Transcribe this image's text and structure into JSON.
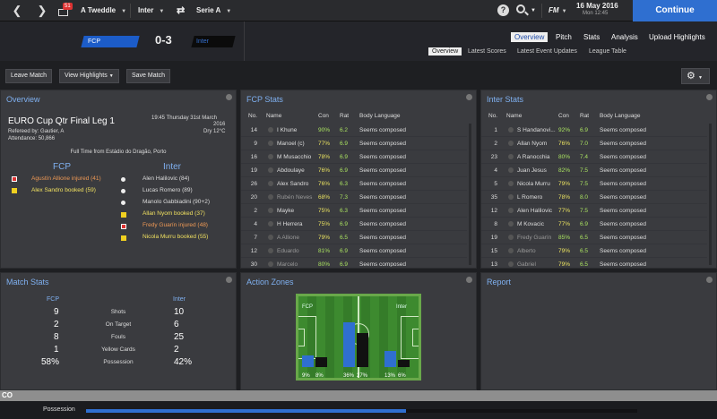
{
  "topbar": {
    "mail_badge": "51",
    "manager": "A Tweddle",
    "team": "Inter",
    "competition": "Serie A",
    "help": "?",
    "fm_label": "FM",
    "date": "16 May 2016",
    "time": "Mon 12:45",
    "continue": "Continue"
  },
  "match": {
    "home_team": "FCP",
    "away_team": "Inter",
    "score": "0-3"
  },
  "tabs": [
    "Overview",
    "Pitch",
    "Stats",
    "Analysis",
    "Upload Highlights"
  ],
  "subtabs": [
    "Overview",
    "Latest Scores",
    "Latest Event Updates",
    "League Table"
  ],
  "toolbar": {
    "leave": "Leave Match",
    "highlights": "View Highlights",
    "save": "Save Match"
  },
  "overview": {
    "title": "Overview",
    "match_title": "EURO Cup Qtr Final Leg 1",
    "kickoff": "19:45 Thursday 31st March",
    "year": "2016",
    "referee": "Refereed by: Gautier, A",
    "weather": "Dry 12°C",
    "attendance": "Attendance: 50,866",
    "full_time": "Full Time from Estádio do Dragão, Porto",
    "home_head": "FCP",
    "away_head": "Inter",
    "home_events": [
      {
        "text": "Agustín Allione injured (41)",
        "kind": "inj"
      },
      {
        "text": "Alex Sandro booked (59)",
        "kind": "yel"
      }
    ],
    "away_events": [
      {
        "text": "Alen Halilovic (84)",
        "kind": "goal"
      },
      {
        "text": "Lucas Romero (89)",
        "kind": "goal"
      },
      {
        "text": "Manolo Gabbiadini (90+2)",
        "kind": "goal"
      },
      {
        "text": "Allan Nyom booked (37)",
        "kind": "yel"
      },
      {
        "text": "Fredy Guarín injured (48)",
        "kind": "inj"
      },
      {
        "text": "Nicola Murru booked (55)",
        "kind": "yel"
      }
    ]
  },
  "fcp_stats": {
    "title": "FCP Stats",
    "headers": {
      "no": "No.",
      "name": "Name",
      "con": "Con",
      "rat": "Rat",
      "body": "Body Language"
    },
    "rows": [
      {
        "no": "14",
        "name": "I Khune",
        "con": "90%",
        "rat": "6.2",
        "body": "Seems composed",
        "sub": false
      },
      {
        "no": "9",
        "name": "Manoel (c)",
        "con": "77%",
        "rat": "6.9",
        "body": "Seems composed",
        "sub": false
      },
      {
        "no": "16",
        "name": "M Musacchio",
        "con": "78%",
        "rat": "6.9",
        "body": "Seems composed",
        "sub": false
      },
      {
        "no": "19",
        "name": "Abdoulaye",
        "con": "76%",
        "rat": "6.9",
        "body": "Seems composed",
        "sub": false
      },
      {
        "no": "26",
        "name": "Alex Sandro",
        "con": "76%",
        "rat": "6.3",
        "body": "Seems composed",
        "sub": false
      },
      {
        "no": "20",
        "name": "Rubén Neves",
        "con": "68%",
        "rat": "7.3",
        "body": "Seems composed",
        "sub": true
      },
      {
        "no": "2",
        "name": "Mayke",
        "con": "75%",
        "rat": "6.3",
        "body": "Seems composed",
        "sub": false
      },
      {
        "no": "4",
        "name": "H Herrera",
        "con": "75%",
        "rat": "6.9",
        "body": "Seems composed",
        "sub": false
      },
      {
        "no": "7",
        "name": "A Allione",
        "con": "79%",
        "rat": "6.5",
        "body": "Seems composed",
        "sub": true
      },
      {
        "no": "12",
        "name": "Eduardo",
        "con": "81%",
        "rat": "6.9",
        "body": "Seems composed",
        "sub": true
      },
      {
        "no": "30",
        "name": "Marcelo",
        "con": "80%",
        "rat": "6.9",
        "body": "Seems composed",
        "sub": true
      }
    ]
  },
  "inter_stats": {
    "title": "Inter Stats",
    "headers": {
      "no": "No.",
      "name": "Name",
      "con": "Con",
      "rat": "Rat",
      "body": "Body Language"
    },
    "rows": [
      {
        "no": "1",
        "name": "S Handanovi...",
        "con": "92%",
        "rat": "6.9",
        "body": "Seems composed",
        "sub": false
      },
      {
        "no": "2",
        "name": "Allan Nyom",
        "con": "76%",
        "rat": "7.0",
        "body": "Seems composed",
        "sub": false
      },
      {
        "no": "23",
        "name": "A Ranocchia",
        "con": "80%",
        "rat": "7.4",
        "body": "Seems composed",
        "sub": false
      },
      {
        "no": "4",
        "name": "Juan Jesus",
        "con": "82%",
        "rat": "7.5",
        "body": "Seems composed",
        "sub": false
      },
      {
        "no": "5",
        "name": "Nicola Murru",
        "con": "79%",
        "rat": "7.5",
        "body": "Seems composed",
        "sub": false
      },
      {
        "no": "35",
        "name": "L Romero",
        "con": "78%",
        "rat": "8.0",
        "body": "Seems composed",
        "sub": false
      },
      {
        "no": "12",
        "name": "Alen Halilovic",
        "con": "77%",
        "rat": "7.5",
        "body": "Seems composed",
        "sub": false
      },
      {
        "no": "8",
        "name": "M Kovacic",
        "con": "77%",
        "rat": "6.9",
        "body": "Seems composed",
        "sub": false
      },
      {
        "no": "19",
        "name": "Fredy Guarín",
        "con": "85%",
        "rat": "6.5",
        "body": "Seems composed",
        "sub": true
      },
      {
        "no": "15",
        "name": "Alberto",
        "con": "79%",
        "rat": "6.5",
        "body": "Seems composed",
        "sub": true
      },
      {
        "no": "13",
        "name": "Gabriel",
        "con": "79%",
        "rat": "6.5",
        "body": "Seems composed",
        "sub": true
      }
    ]
  },
  "match_stats": {
    "title": "Match Stats",
    "home": "FCP",
    "away": "Inter",
    "rows": [
      {
        "label": "Shots",
        "home": "9",
        "away": "10"
      },
      {
        "label": "On Target",
        "home": "2",
        "away": "6"
      },
      {
        "label": "Fouls",
        "home": "8",
        "away": "25"
      },
      {
        "label": "Yellow Cards",
        "home": "1",
        "away": "2"
      },
      {
        "label": "Possession",
        "home": "58%",
        "away": "42%"
      }
    ]
  },
  "action_zones": {
    "title": "Action Zones",
    "home": "FCP",
    "away": "Inter",
    "zones": [
      {
        "home": 9,
        "away": 8
      },
      {
        "home": 36,
        "away": 27
      },
      {
        "home": 13,
        "away": 6
      }
    ],
    "home_color": "#2f6fd0",
    "away_color": "#111111"
  },
  "report": {
    "title": "Report"
  },
  "possession": {
    "label": "Possession",
    "home": 58,
    "strip_tag": "CO",
    "color": "#2f6fd0"
  }
}
